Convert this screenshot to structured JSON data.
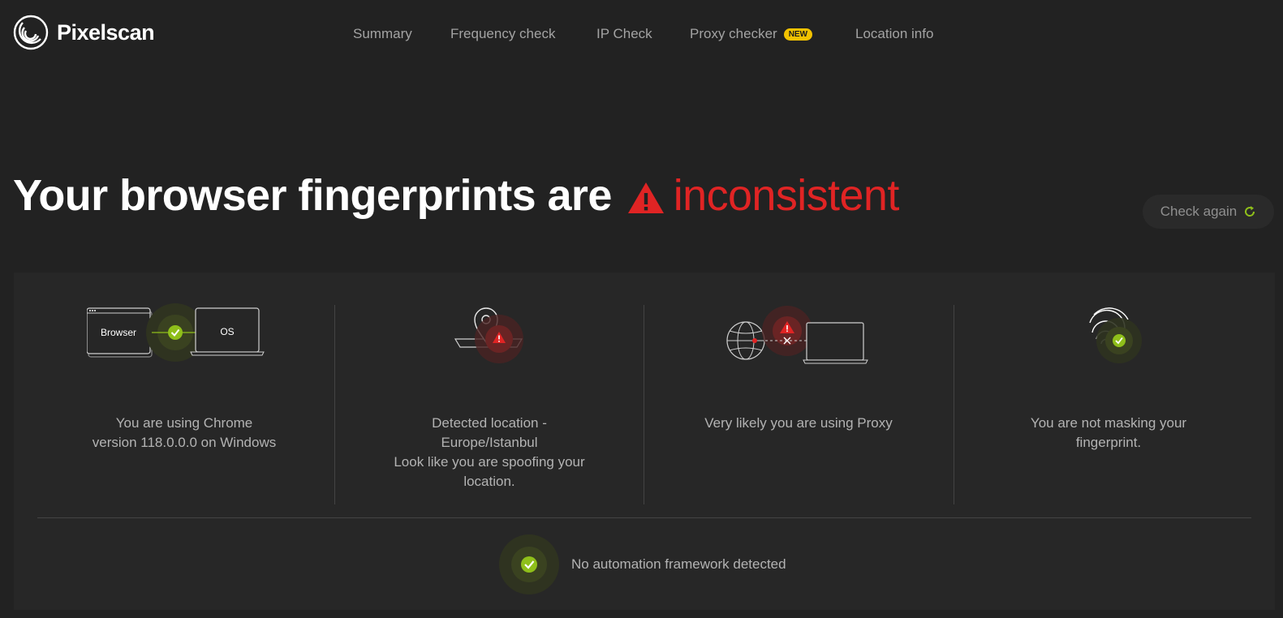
{
  "brand": {
    "name": "Pixelscan"
  },
  "nav": {
    "items": [
      {
        "label": "Summary"
      },
      {
        "label": "Frequency check"
      },
      {
        "label": "IP Check"
      },
      {
        "label": "Proxy checker",
        "badge": "NEW"
      },
      {
        "label": "Location info"
      }
    ]
  },
  "headline": {
    "prefix": "Your browser fingerprints are",
    "status": "inconsistent",
    "status_color": "#e02424"
  },
  "check_again": {
    "label": "Check again",
    "icon": "refresh-icon"
  },
  "cards": [
    {
      "illustration": {
        "browser_label": "Browser",
        "os_label": "OS",
        "status": "ok"
      },
      "lines": [
        "You are using Chrome",
        "version 118.0.0.0 on Windows"
      ]
    },
    {
      "illustration": {
        "status": "warning"
      },
      "lines": [
        "Detected location -",
        "Europe/Istanbul",
        "Look like you are spoofing your",
        "location."
      ]
    },
    {
      "illustration": {
        "status": "warning"
      },
      "lines": [
        "Very likely you are using Proxy"
      ]
    },
    {
      "illustration": {
        "status": "ok"
      },
      "lines": [
        "You are not masking your",
        "fingerprint."
      ]
    }
  ],
  "automation": {
    "label": "No automation framework detected",
    "status": "ok"
  },
  "colors": {
    "background": "#222222",
    "panel": "#272727",
    "ok_green": "#8fbf1a",
    "warn_red": "#e02424",
    "badge_yellow": "#f2c200",
    "muted_text": "#b3b3b3"
  }
}
